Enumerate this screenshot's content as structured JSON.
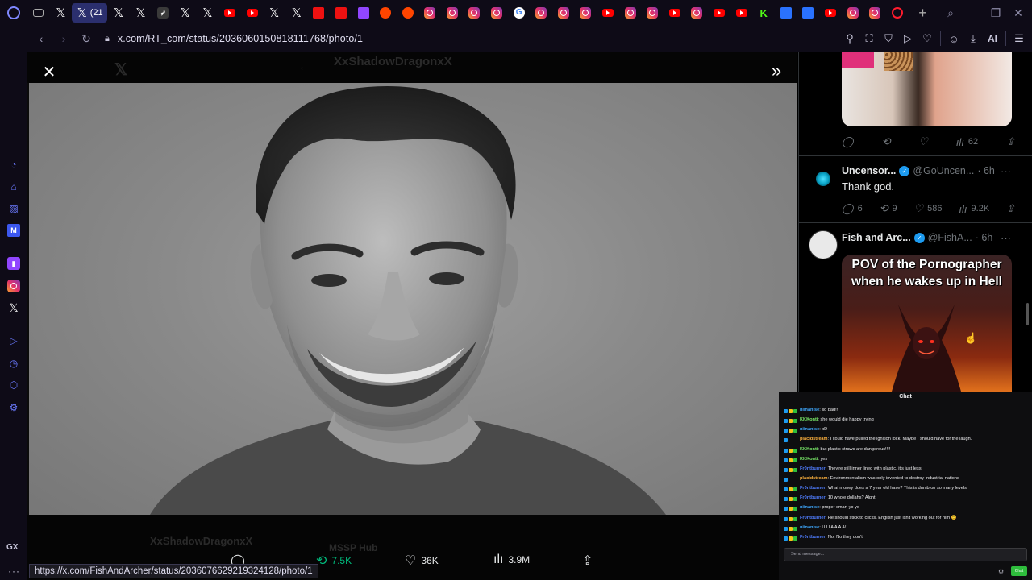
{
  "browser": {
    "url": "x.com/RT_com/status/2036060150818111768/photo/1",
    "active_tab_count": "(21",
    "status_link": "https://x.com/FishAndArcher/status/2036076629219324128/photo/1",
    "ai_label": "AI",
    "sidebar_label": "GX",
    "tabs": [
      "game",
      "x",
      "x-active",
      "x",
      "x",
      "dk",
      "x",
      "x",
      "yt",
      "yt",
      "x",
      "x",
      "red",
      "red",
      "tw",
      "rd",
      "rd",
      "ig",
      "ig",
      "ig",
      "ig",
      "g",
      "ig",
      "ig",
      "ig",
      "yt",
      "ig",
      "ig",
      "yt",
      "ig",
      "yt",
      "yt",
      "k",
      "ms",
      "ms",
      "yt",
      "ig",
      "ig",
      "ot"
    ]
  },
  "viewer": {
    "ghost_name": "XxShadowDragonxX",
    "ghost_reply_name": "XxShadowDragonxX",
    "ghost_hub": "MSSP Hub",
    "retweets": "7.5K",
    "likes": "36K",
    "views": "3.9M"
  },
  "timeline": {
    "post1": {
      "views": "62"
    },
    "post2": {
      "name": "Uncensor...",
      "handle": "@GoUncen...",
      "time": "· 6h",
      "text": "Thank god.",
      "replies": "6",
      "retweets": "9",
      "likes": "586",
      "views": "9.2K"
    },
    "post3": {
      "name": "Fish and Arc...",
      "handle": "@FishA...",
      "time": "· 6h",
      "meme_caption": "POV of the Pornographer when he wakes up in Hell"
    }
  },
  "chat": {
    "title": "Chat",
    "input_placeholder": "Send message...",
    "button": "Chat",
    "messages": [
      {
        "user": "niinanise",
        "color": "#3fa9ff",
        "text": "so bad!!"
      },
      {
        "user": "KKKonti",
        "color": "#7cf06b",
        "text": "she would die happy trying"
      },
      {
        "user": "niinanise",
        "color": "#3fa9ff",
        "text": "xD"
      },
      {
        "user": "placidstream",
        "color": "#ffb23e",
        "text": "I could have pulled the ignition lock. Maybe I should have for the laugh."
      },
      {
        "user": "KKKonti",
        "color": "#7cf06b",
        "text": "but plastic straws are dangerous!!!!"
      },
      {
        "user": "KKKonti",
        "color": "#7cf06b",
        "text": "yes"
      },
      {
        "user": "Fr0ntburner",
        "color": "#4f7dff",
        "text": "They're still inner lined with plastic, it's just less"
      },
      {
        "user": "placidstream",
        "color": "#ffb23e",
        "text": "Environmentalism was only invented to destroy industrial nations"
      },
      {
        "user": "Fr0ntburner",
        "color": "#4f7dff",
        "text": "What money does a 7 year old have? This is dumb on so many levels"
      },
      {
        "user": "Fr0ntburner",
        "color": "#4f7dff",
        "text": "10 whole dollahs? Alght"
      },
      {
        "user": "niinanise",
        "color": "#3fa9ff",
        "text": "proper smart yo yo"
      },
      {
        "user": "Fr0ntburner",
        "color": "#4f7dff",
        "text": "He should stick to clicks. English just isn't working out for him 😊"
      },
      {
        "user": "niinanise",
        "color": "#3fa9ff",
        "text": "U U A A A A!"
      },
      {
        "user": "Fr0ntburner",
        "color": "#4f7dff",
        "text": "No. No they don't."
      }
    ]
  }
}
